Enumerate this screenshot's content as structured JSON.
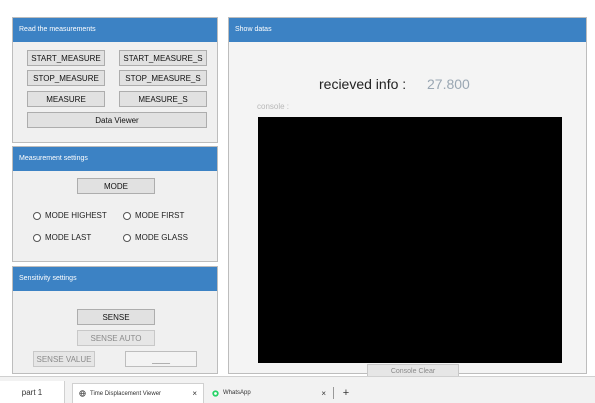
{
  "read_panel": {
    "title": "Read the measurements",
    "buttons": {
      "start_measure": "START_MEASURE",
      "start_measure_s": "START_MEASURE_S",
      "stop_measure": "STOP_MEASURE",
      "stop_measure_s": "STOP_MEASURE_S",
      "measure": "MEASURE",
      "measure_s": "MEASURE_S",
      "data_viewer": "Data Viewer"
    }
  },
  "measurement_settings": {
    "title": "Measurement settings",
    "mode_button": "MODE",
    "radios": {
      "mode_highest": "MODE HIGHEST",
      "mode_first": "MODE FIRST",
      "mode_last": "MODE LAST",
      "mode_glass": "MODE GLASS"
    }
  },
  "sensitivity_settings": {
    "title": "Sensitivity settings",
    "sense_button": "SENSE",
    "sense_auto_button": "SENSE AUTO",
    "sense_value_label": "SENSE VALUE",
    "sense_value_field": "____"
  },
  "show_panel": {
    "title": "Show datas",
    "received_label": "recieved info :",
    "received_value": "27.800",
    "console_label": "console :",
    "console_clear": "Console Clear"
  },
  "taskbar": {
    "part_label": "part 1",
    "tabs": [
      {
        "title": "Time Displacement Viewer",
        "close": "×"
      },
      {
        "title": "WhatsApp",
        "close": "×"
      }
    ],
    "new_tab": "+"
  },
  "colors": {
    "title_bar": "#3c82c4",
    "console_bg": "#000000",
    "value_text": "#9aa7b3"
  }
}
